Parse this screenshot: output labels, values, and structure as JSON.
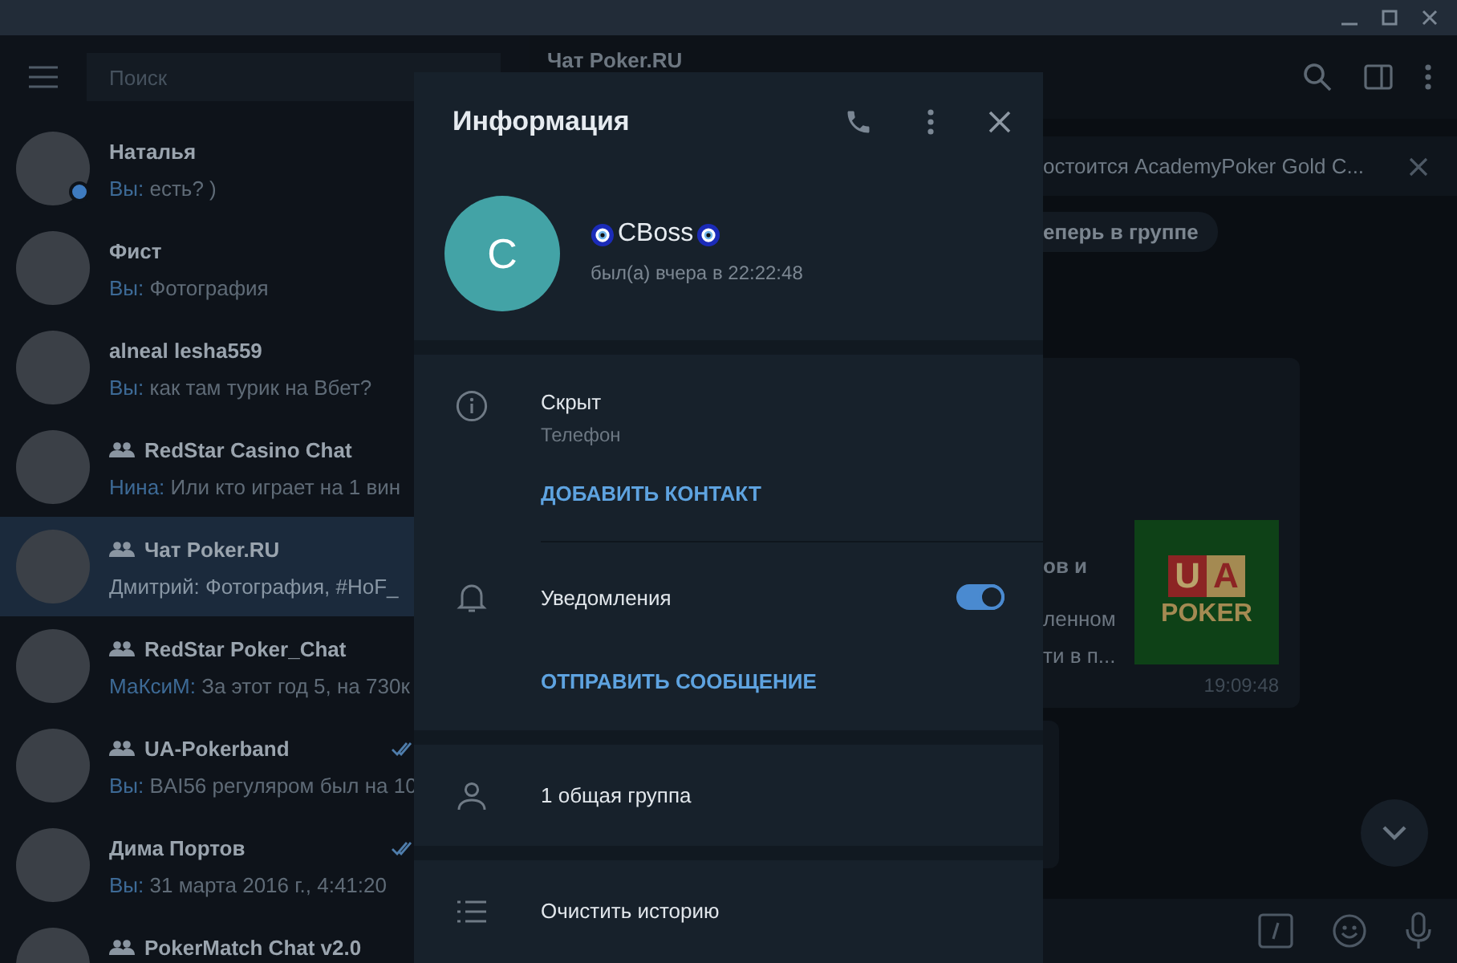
{
  "sidebar": {
    "search": {
      "placeholder": "Поиск"
    },
    "chats": [
      {
        "name": "Наталья",
        "group": false,
        "sender": "Вы:",
        "preview": "есть? )",
        "selected": false,
        "read": false,
        "online": true
      },
      {
        "name": "Фист",
        "group": false,
        "sender": "Вы:",
        "preview": "Фотография",
        "selected": false,
        "read": false,
        "online": false
      },
      {
        "name": "alneal lesha559",
        "group": false,
        "sender": "Вы:",
        "preview": "как там турик на Вбет?",
        "selected": false,
        "read": false,
        "online": false
      },
      {
        "name": "RedStar Casino Chat",
        "group": true,
        "sender": "Нина:",
        "preview": "Или кто играет на 1 вин",
        "selected": false,
        "read": false,
        "online": false
      },
      {
        "name": "Чат Poker.RU",
        "group": true,
        "sender": "Дмитрий:",
        "preview": "Фотография, #HoF_",
        "selected": true,
        "read": false,
        "online": false
      },
      {
        "name": "RedStar Poker_Chat",
        "group": true,
        "sender": "МаКсиМ:",
        "preview": "За этот год 5, на 730к",
        "selected": false,
        "read": false,
        "online": false
      },
      {
        "name": "UA-Pokerband",
        "group": true,
        "sender": "Вы:",
        "preview": "BAI56 регуляром был на 10",
        "selected": false,
        "read": true,
        "online": false
      },
      {
        "name": "Дима Портов",
        "group": false,
        "sender": "Вы:",
        "preview": "31 марта 2016 г., 4:41:20",
        "selected": false,
        "read": true,
        "online": false
      },
      {
        "name": "PokerMatch Chat v2.0",
        "group": true,
        "selected": false,
        "read": false,
        "online": false
      }
    ]
  },
  "chat": {
    "title": "Чат Poker.RU",
    "pinned": "остоится AcademyPoker Gold C...",
    "service": "еперь в группе",
    "message": {
      "lines": [
        "ов и",
        "ленном",
        "ти в п..."
      ],
      "logo_top": [
        "U",
        "A"
      ],
      "logo_bottom": "POKER",
      "time": "19:09:48"
    }
  },
  "profile": {
    "title": "Информация",
    "avatar_letter": "C",
    "name": "CBoss",
    "status": "был(а) вчера в 22:22:48",
    "phone": {
      "value": "Скрыт",
      "label": "Телефон"
    },
    "add_contact": "ДОБАВИТЬ КОНТАКТ",
    "notifications": {
      "label": "Уведомления",
      "on": true
    },
    "send_message": "ОТПРАВИТЬ СООБЩЕНИЕ",
    "common_groups": "1 общая группа",
    "clear_history": "Очистить историю"
  }
}
